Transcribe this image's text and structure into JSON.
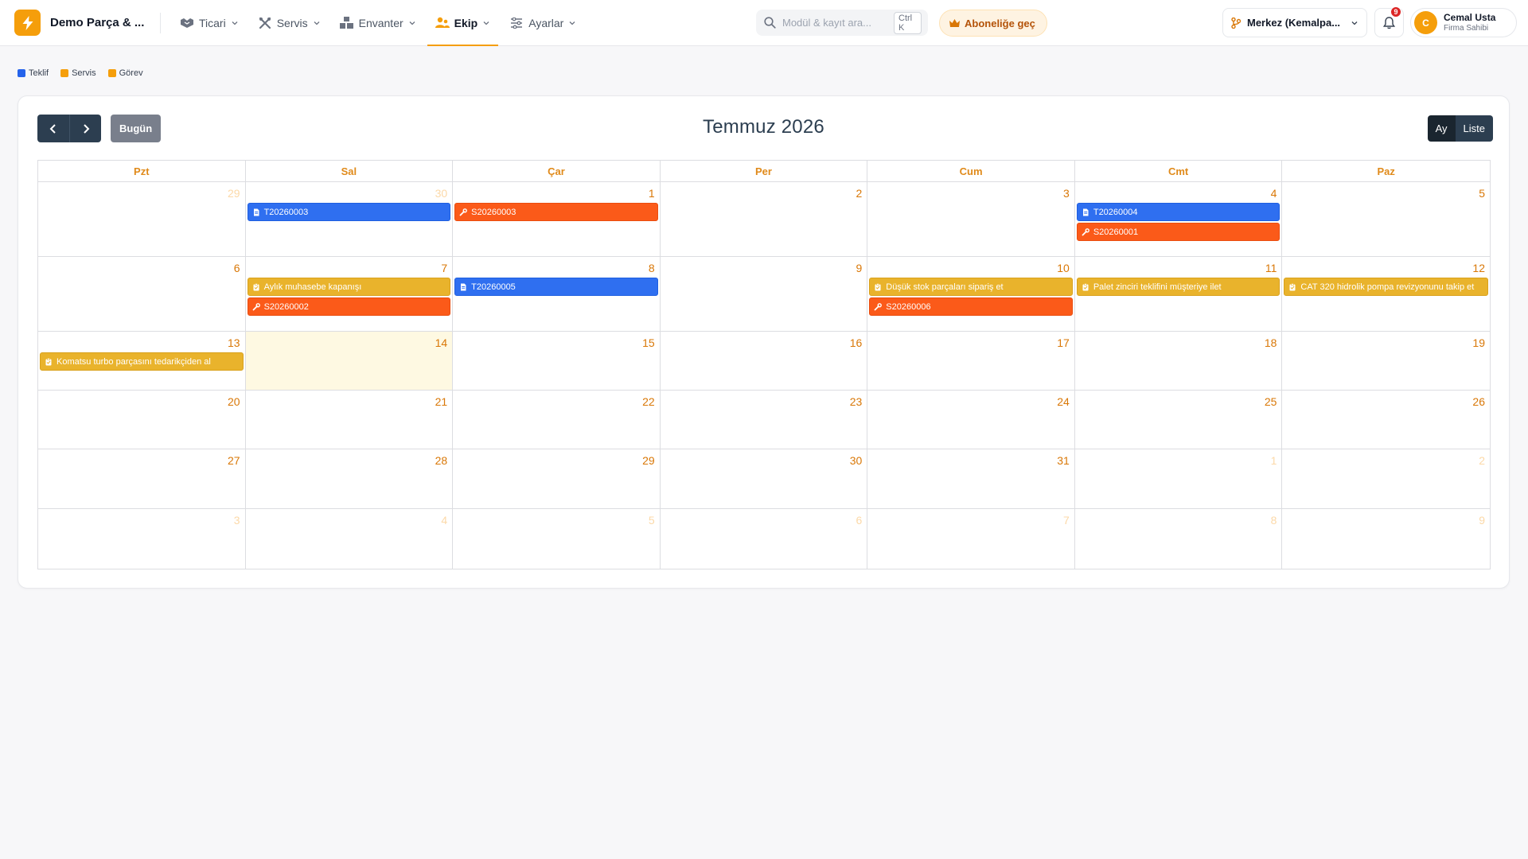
{
  "brand": {
    "name": "Demo Parça & ...",
    "logo_icon": "lightning-icon",
    "color": "#f59e0b"
  },
  "nav": [
    {
      "key": "ticari",
      "label": "Ticari",
      "icon": "handshake-icon",
      "active": false
    },
    {
      "key": "servis",
      "label": "Servis",
      "icon": "tools-icon",
      "active": false
    },
    {
      "key": "envanter",
      "label": "Envanter",
      "icon": "boxes-icon",
      "active": false
    },
    {
      "key": "ekip",
      "label": "Ekip",
      "icon": "team-icon",
      "active": true
    },
    {
      "key": "ayarlar",
      "label": "Ayarlar",
      "icon": "sliders-icon",
      "active": false
    }
  ],
  "search": {
    "placeholder": "Modül & kayıt ara...",
    "value": "",
    "shortcut": "Ctrl K"
  },
  "upgrade": {
    "label": "Aboneliğe geç"
  },
  "branch": {
    "label": "Merkez (Kemalpa..."
  },
  "notifications": {
    "count": "9"
  },
  "user": {
    "initial": "C",
    "name": "Cemal Usta",
    "role": "Firma Sahibi"
  },
  "legend": [
    {
      "label": "Teklif",
      "color": "#2563eb"
    },
    {
      "label": "Servis",
      "color": "#f59e0b"
    },
    {
      "label": "Görev",
      "color": "#f59e0b"
    }
  ],
  "calendar": {
    "title": "Temmuz 2026",
    "today_label": "Bugün",
    "views": {
      "month": "Ay",
      "list": "Liste"
    },
    "days_of_week": [
      "Pzt",
      "Sal",
      "Çar",
      "Per",
      "Cum",
      "Cmt",
      "Paz"
    ],
    "weeks": [
      {
        "days": [
          {
            "n": "29",
            "other": true,
            "events": []
          },
          {
            "n": "30",
            "other": true,
            "events": [
              {
                "type": "teklif",
                "label": "T20260003"
              }
            ]
          },
          {
            "n": "1",
            "events": [
              {
                "type": "servis",
                "label": "S20260003"
              }
            ]
          },
          {
            "n": "2",
            "events": []
          },
          {
            "n": "3",
            "events": []
          },
          {
            "n": "4",
            "events": [
              {
                "type": "teklif",
                "label": "T20260004"
              },
              {
                "type": "servis",
                "label": "S20260001"
              }
            ]
          },
          {
            "n": "5",
            "events": []
          }
        ]
      },
      {
        "days": [
          {
            "n": "6",
            "events": []
          },
          {
            "n": "7",
            "events": [
              {
                "type": "gorev",
                "label": "Aylık muhasebe kapanışı"
              },
              {
                "type": "servis",
                "label": "S20260002"
              }
            ]
          },
          {
            "n": "8",
            "events": [
              {
                "type": "teklif",
                "label": "T20260005"
              }
            ]
          },
          {
            "n": "9",
            "events": []
          },
          {
            "n": "10",
            "events": [
              {
                "type": "gorev",
                "label": "Düşük stok parçaları sipariş et"
              },
              {
                "type": "servis",
                "label": "S20260006"
              }
            ]
          },
          {
            "n": "11",
            "events": [
              {
                "type": "gorev",
                "label": "Palet zinciri teklifini müşteriye ilet"
              }
            ]
          },
          {
            "n": "12",
            "events": [
              {
                "type": "gorev",
                "label": "CAT 320 hidrolik pompa revizyonunu takip et"
              }
            ]
          }
        ]
      },
      {
        "days": [
          {
            "n": "13",
            "events": [
              {
                "type": "gorev",
                "label": "Komatsu turbo parçasını tedarikçiden al"
              }
            ]
          },
          {
            "n": "14",
            "today": true,
            "events": []
          },
          {
            "n": "15",
            "events": []
          },
          {
            "n": "16",
            "events": []
          },
          {
            "n": "17",
            "events": []
          },
          {
            "n": "18",
            "events": []
          },
          {
            "n": "19",
            "events": []
          }
        ]
      },
      {
        "days": [
          {
            "n": "20",
            "events": []
          },
          {
            "n": "21",
            "events": []
          },
          {
            "n": "22",
            "events": []
          },
          {
            "n": "23",
            "events": []
          },
          {
            "n": "24",
            "events": []
          },
          {
            "n": "25",
            "events": []
          },
          {
            "n": "26",
            "events": []
          }
        ]
      },
      {
        "days": [
          {
            "n": "27",
            "events": []
          },
          {
            "n": "28",
            "events": []
          },
          {
            "n": "29",
            "events": []
          },
          {
            "n": "30",
            "events": []
          },
          {
            "n": "31",
            "events": []
          },
          {
            "n": "1",
            "other": true,
            "events": []
          },
          {
            "n": "2",
            "other": true,
            "events": []
          }
        ]
      },
      {
        "days": [
          {
            "n": "3",
            "other": true,
            "events": []
          },
          {
            "n": "4",
            "other": true,
            "events": []
          },
          {
            "n": "5",
            "other": true,
            "events": []
          },
          {
            "n": "6",
            "other": true,
            "events": []
          },
          {
            "n": "7",
            "other": true,
            "events": []
          },
          {
            "n": "8",
            "other": true,
            "events": []
          },
          {
            "n": "9",
            "other": true,
            "events": []
          }
        ]
      }
    ]
  }
}
